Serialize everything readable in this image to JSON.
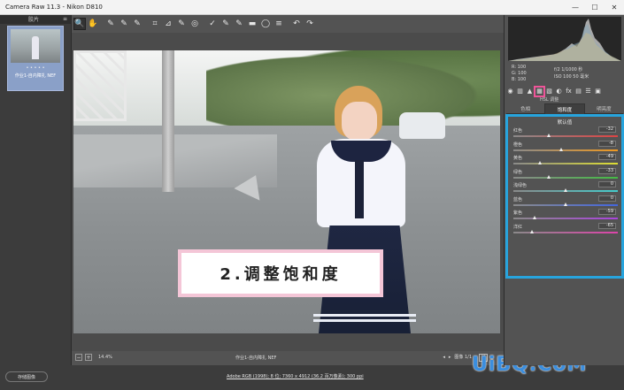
{
  "window": {
    "title": "Camera Raw 11.3 -  Nikon D810",
    "min": "—",
    "max": "☐",
    "close": "✕"
  },
  "filmstrip": {
    "header": "胶片",
    "menu_icon": "≡",
    "thumb": {
      "stars": "• • • • •",
      "name": "作业1-自内障扎 NEF"
    }
  },
  "toolbar": {
    "tools": [
      "🔍",
      "✋",
      "✎",
      "✎",
      "✎",
      "⌗",
      "⊿",
      "✎",
      "◎",
      "✓",
      "✎",
      "✎",
      "▬",
      "◯",
      "≡",
      "↶",
      "↷"
    ]
  },
  "caption": {
    "text": "2.调整饱和度"
  },
  "status": {
    "zoom_minus": "−",
    "zoom_plus": "+",
    "zoom": "14.4%",
    "filename": "作业1-自内障扎 NEF",
    "prev": "◂",
    "next": "▸",
    "count": "图像 1/1",
    "view": "Y"
  },
  "bottom": {
    "save_label": "存储图像",
    "workflow_link": "Adobe RGB (1998); 8 位; 7360 x 4912 (36.2 百万像素); 300 ppi",
    "watermark": "UiBQ.CoM"
  },
  "readout": {
    "rgb": [
      "R:  100",
      "G:  100",
      "B:  100"
    ],
    "camera": [
      "f/2   1/1000 秒",
      "ISO 100   50 毫米"
    ]
  },
  "panel": {
    "icons": [
      "◉",
      "▥",
      "▲",
      "▦",
      "▧",
      "◐",
      "fx",
      "▤",
      "☰",
      "▣"
    ],
    "section_title": "HSL 调整",
    "tabs": [
      "色相",
      "饱和度",
      "明亮度"
    ],
    "adjust_title": "默认值",
    "sliders": [
      {
        "label": "红色",
        "value": "-32",
        "v": -32,
        "color": "#d44"
      },
      {
        "label": "橙色",
        "value": "-8",
        "v": -8,
        "color": "#e92"
      },
      {
        "label": "黄色",
        "value": "-49",
        "v": -49,
        "color": "#dd3"
      },
      {
        "label": "绿色",
        "value": "-33",
        "v": -33,
        "color": "#4b4"
      },
      {
        "label": "浅绿色",
        "value": "0",
        "v": 0,
        "color": "#4cc"
      },
      {
        "label": "蓝色",
        "value": "0",
        "v": 0,
        "color": "#46d"
      },
      {
        "label": "紫色",
        "value": "-59",
        "v": -59,
        "color": "#a4d"
      },
      {
        "label": "洋红",
        "value": "-65",
        "v": -65,
        "color": "#d4a"
      }
    ]
  }
}
